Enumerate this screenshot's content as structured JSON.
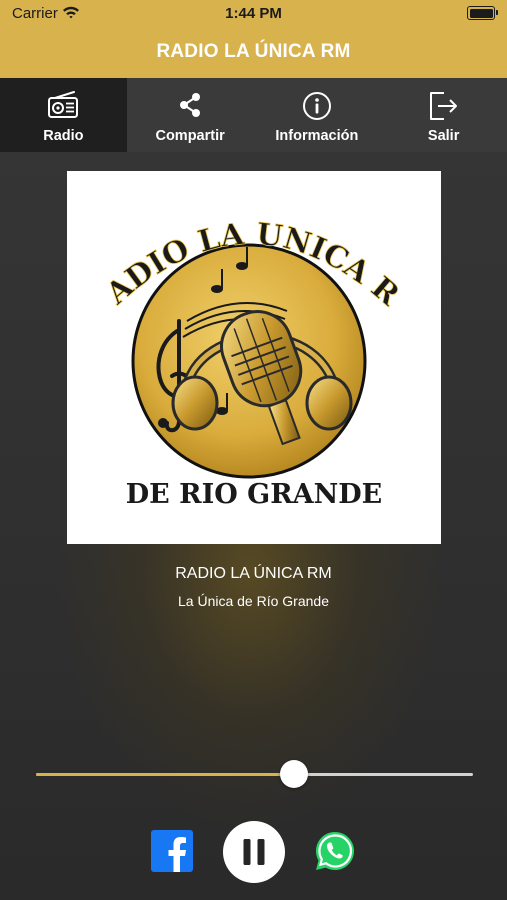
{
  "status": {
    "carrier": "Carrier",
    "time": "1:44 PM"
  },
  "header": {
    "title": "RADIO LA ÚNICA RM"
  },
  "tabs": [
    {
      "label": "Radio",
      "icon": "radio-icon",
      "active": true
    },
    {
      "label": "Compartir",
      "icon": "share-icon",
      "active": false
    },
    {
      "label": "Información",
      "icon": "info-icon",
      "active": false
    },
    {
      "label": "Salir",
      "icon": "logout-icon",
      "active": false
    }
  ],
  "logo": {
    "top_text": "RADIO LA UNICA RM",
    "bottom_text": "DE RIO GRANDE"
  },
  "station": {
    "name": "RADIO LA ÚNICA RM",
    "slogan": "La Única de Río Grande"
  },
  "player": {
    "volume_fraction": 0.59,
    "state": "playing",
    "control_icon": "pause-icon"
  },
  "social": [
    {
      "icon": "facebook-icon"
    },
    {
      "icon": "whatsapp-icon"
    }
  ],
  "colors": {
    "accent": "#d8b24d",
    "tab_bar": "#3a3a3a",
    "tab_active": "#1f1f1f",
    "background": "#2b2b2b",
    "facebook": "#1877f2",
    "whatsapp": "#25d366"
  }
}
